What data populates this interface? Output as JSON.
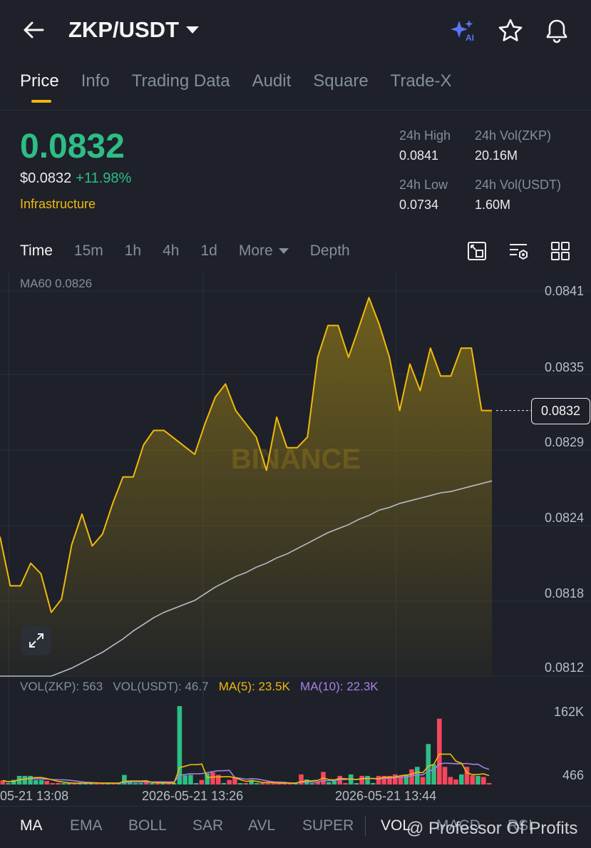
{
  "header": {
    "pair": "ZKP/USDT",
    "icons": [
      "back-arrow-icon",
      "ai-sparkle-icon",
      "star-icon",
      "bell-icon"
    ]
  },
  "tabs": [
    {
      "label": "Price",
      "active": true
    },
    {
      "label": "Info"
    },
    {
      "label": "Trading Data"
    },
    {
      "label": "Audit"
    },
    {
      "label": "Square"
    },
    {
      "label": "Trade-X"
    }
  ],
  "price": {
    "last": "0.0832",
    "usd": "$0.0832",
    "change": "+11.98%",
    "category": "Infrastructure",
    "high_label": "24h High",
    "high": "0.0841",
    "vol_base_label": "24h Vol(ZKP)",
    "vol_base": "20.16M",
    "low_label": "24h Low",
    "low": "0.0734",
    "vol_quote_label": "24h Vol(USDT)",
    "vol_quote": "1.60M"
  },
  "intervals": {
    "items": [
      "Time",
      "15m",
      "1h",
      "4h",
      "1d",
      "More",
      "Depth"
    ],
    "active": "Time"
  },
  "chart": {
    "ma60_label": "MA60 0.0826",
    "y_labels": [
      "0.0841",
      "0.0835",
      "0.0829",
      "0.0824",
      "0.0818",
      "0.0812"
    ],
    "current": "0.0832",
    "x_labels": [
      "05-21 13:08",
      "2026-05-21 13:26",
      "2026-05-21 13:44"
    ],
    "watermark": "BINANCE",
    "vol_ylabels": [
      "162K",
      "466"
    ],
    "vol_legend": {
      "base": "VOL(ZKP): 563",
      "quote": "VOL(USDT): 46.7",
      "ma5": "MA(5): 23.5K",
      "ma10": "MA(10): 22.3K"
    },
    "colors": {
      "price_line": "#f0b90b",
      "ma60": "#b7bdc6",
      "up": "#2ebd85",
      "down": "#f6465d",
      "ma5": "#f0b90b",
      "ma10": "#a680e6"
    }
  },
  "chart_data": {
    "type": "line",
    "y_range": [
      0.0812,
      0.0841
    ],
    "price": [
      0.08225,
      0.08188,
      0.08188,
      0.08205,
      0.08197,
      0.08168,
      0.08178,
      0.08219,
      0.08242,
      0.08218,
      0.08227,
      0.0825,
      0.0827,
      0.0827,
      0.08294,
      0.08305,
      0.08305,
      0.08299,
      0.08293,
      0.08287,
      0.0831,
      0.0833,
      0.0834,
      0.0832,
      0.0831,
      0.083,
      0.08275,
      0.08315,
      0.08292,
      0.08292,
      0.083,
      0.0836,
      0.08384,
      0.08384,
      0.0836,
      0.08382,
      0.08405,
      0.08385,
      0.0836,
      0.0832,
      0.08355,
      0.08335,
      0.08367,
      0.08346,
      0.08346,
      0.08367,
      0.08367,
      0.0832,
      0.0832
    ],
    "ma60": [
      0.0812,
      0.0812,
      0.0812,
      0.0812,
      0.0812,
      0.0812,
      0.08123,
      0.08126,
      0.0813,
      0.08134,
      0.08138,
      0.08143,
      0.08148,
      0.08154,
      0.08159,
      0.08164,
      0.08168,
      0.08171,
      0.08174,
      0.08177,
      0.08182,
      0.08187,
      0.08191,
      0.08195,
      0.08198,
      0.08202,
      0.08205,
      0.08209,
      0.08212,
      0.08216,
      0.0822,
      0.08224,
      0.08228,
      0.08231,
      0.08234,
      0.08238,
      0.08241,
      0.08245,
      0.08247,
      0.0825,
      0.08252,
      0.08254,
      0.08256,
      0.08258,
      0.08259,
      0.08261,
      0.08263,
      0.08265,
      0.08267
    ],
    "volume_up": [
      false,
      true,
      true,
      true,
      true,
      true,
      true,
      true,
      false,
      false,
      false,
      true,
      true,
      false,
      true,
      true,
      true,
      false,
      false,
      true,
      false,
      true,
      true,
      true,
      true,
      true,
      false,
      true,
      false,
      true,
      false,
      true,
      true,
      true,
      true,
      true,
      false,
      true,
      false,
      false,
      true,
      false,
      false,
      true,
      false,
      true,
      true,
      false,
      false,
      false,
      false,
      false,
      false,
      true,
      false,
      true,
      true,
      false,
      false,
      true,
      true,
      false,
      false,
      true,
      true,
      false,
      true,
      true,
      false,
      false,
      false,
      false,
      false,
      true,
      false,
      true,
      false,
      true,
      true,
      false,
      false,
      false,
      false,
      true,
      false,
      false,
      true
    ],
    "volume": [
      8,
      3,
      9,
      17,
      17,
      17,
      9,
      9,
      7,
      3,
      3,
      2,
      2,
      3,
      3,
      4,
      3,
      3,
      2,
      3,
      3,
      3,
      19,
      7,
      3,
      3,
      5,
      3,
      3,
      3,
      2,
      3,
      155,
      18,
      19,
      1,
      9,
      22,
      24,
      19,
      3,
      9,
      14,
      2,
      3,
      9,
      3,
      3,
      3,
      2,
      2,
      2,
      2,
      2,
      20,
      10,
      3,
      6,
      25,
      5,
      7,
      17,
      3,
      20,
      3,
      17,
      17,
      3,
      17,
      17,
      17,
      20,
      17,
      20,
      30,
      35,
      15,
      80,
      40,
      130,
      35,
      15,
      10,
      20,
      35,
      18,
      17,
      15,
      3
    ]
  },
  "indicators": {
    "items": [
      "MA",
      "EMA",
      "BOLL",
      "SAR",
      "AVL",
      "SUPER",
      "VOL",
      "MACD",
      "RSI"
    ],
    "active": "MA"
  },
  "overlay": {
    "attribution": "@ Professor Of Profits"
  }
}
